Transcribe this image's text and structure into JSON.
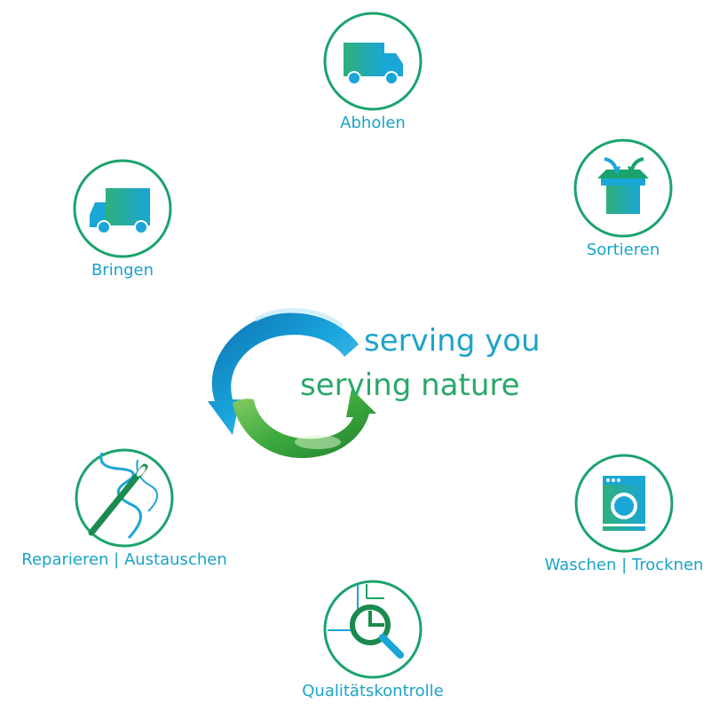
{
  "steps": {
    "abholen": {
      "label": "Abholen",
      "icon": "truck-icon"
    },
    "sortieren": {
      "label": "Sortieren",
      "icon": "sorting-box-icon"
    },
    "waschen": {
      "label": "Waschen | Trocknen",
      "icon": "washing-machine-icon"
    },
    "qualitaet": {
      "label": "Qualitätskontrolle",
      "icon": "magnifier-chart-icon"
    },
    "reparieren": {
      "label": "Reparieren | Austauschen",
      "icon": "needle-thread-icon"
    },
    "bringen": {
      "label": "Bringen",
      "icon": "truck-icon"
    }
  },
  "slogan": {
    "line1": "serving you",
    "line2": "serving  nature"
  },
  "colors": {
    "ring": "#1aa36b",
    "blue": "#19a3c9",
    "green": "#2aa86a"
  }
}
